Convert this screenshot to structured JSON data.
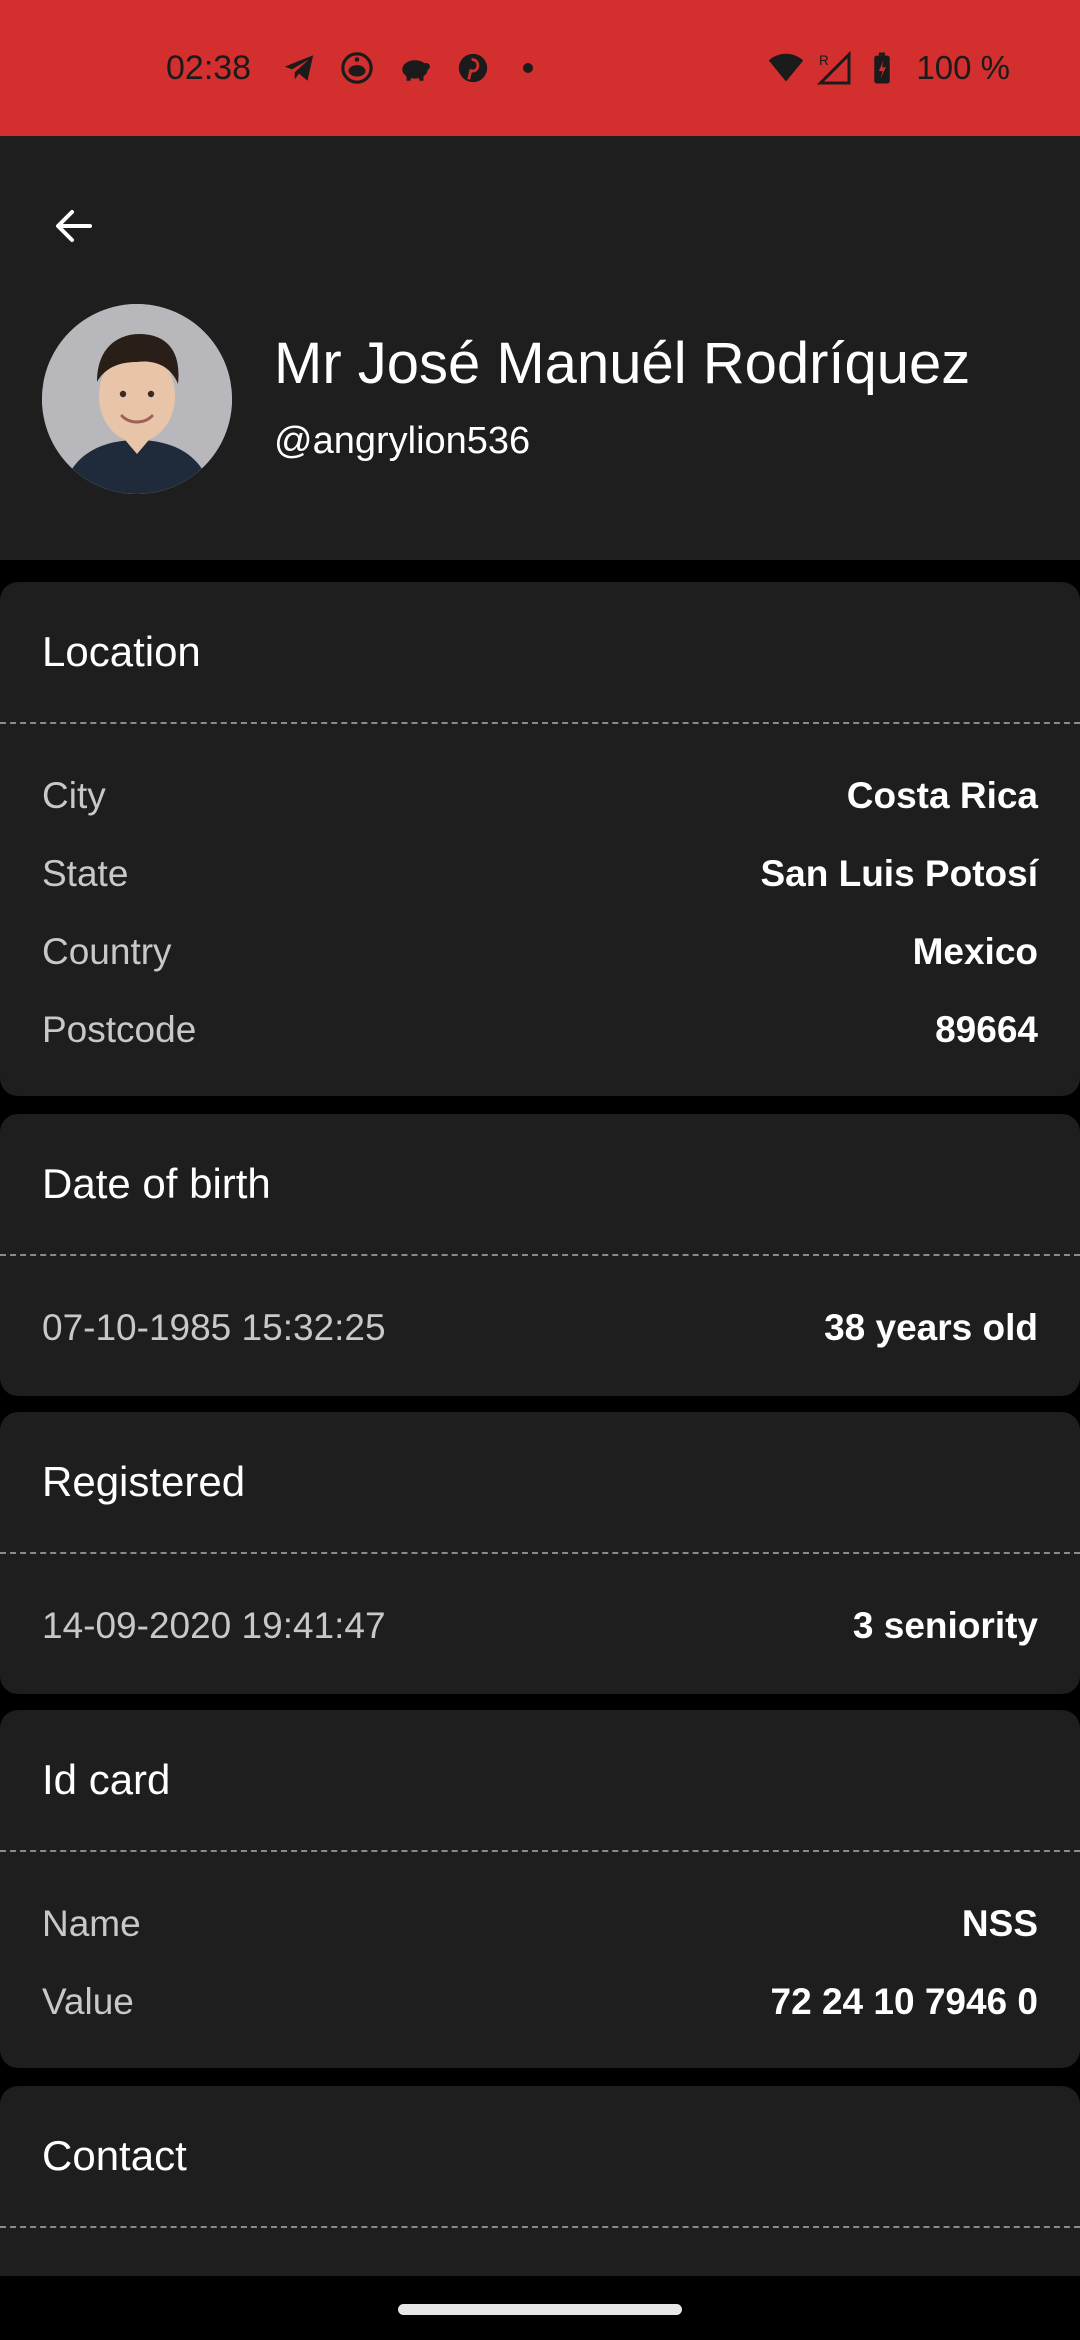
{
  "status_bar": {
    "time": "02:38",
    "notification_icons": [
      "telegram-icon",
      "reddit-icon",
      "piggy-bank-icon",
      "pinterest-icon"
    ],
    "battery": "100 %",
    "background_color": "#d32f2f"
  },
  "header": {
    "name": "Mr José Manuél Rodríquez",
    "username": "@angrylion536"
  },
  "location": {
    "title": "Location",
    "rows": [
      {
        "label": "City",
        "value": "Costa Rica"
      },
      {
        "label": "State",
        "value": "San Luis Potosí"
      },
      {
        "label": "Country",
        "value": "Mexico"
      },
      {
        "label": "Postcode",
        "value": "89664"
      }
    ]
  },
  "dob": {
    "title": "Date of birth",
    "date": "07-10-1985 15:32:25",
    "age": "38 years old"
  },
  "registered": {
    "title": "Registered",
    "date": "14-09-2020 19:41:47",
    "seniority": "3 seniority"
  },
  "id_card": {
    "title": "Id card",
    "rows": [
      {
        "label": "Name",
        "value": "NSS"
      },
      {
        "label": "Value",
        "value": "72 24 10 7946 0"
      }
    ]
  },
  "contact": {
    "title": "Contact"
  },
  "colors": {
    "surface": "#1e1e1e",
    "background": "#000000",
    "accent": "#d32f2f"
  }
}
